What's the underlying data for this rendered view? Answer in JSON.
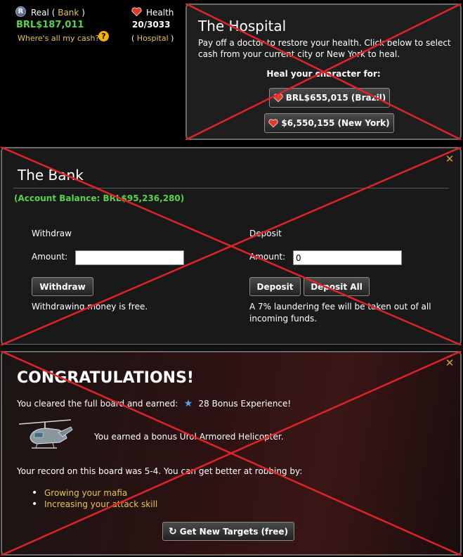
{
  "status": {
    "real_label": "Real",
    "bank_link": "Bank",
    "cash": "BRL$187,011",
    "where_cash": "Where's all my cash?",
    "health_label": "Health",
    "health_value": "20/3033",
    "hospital_link": "Hospital"
  },
  "hospital": {
    "title": "The Hospital",
    "description": "Pay off a doctor to restore your health. Click below to select cash from your current city or New York to heal.",
    "heal_label": "Heal your character for:",
    "brazil_button": "BRL$655,015 (Brazil)",
    "ny_button": "$6,550,155 (New York)"
  },
  "bank": {
    "title": "The Bank",
    "balance": "(Account Balance: BRL$95,236,280)",
    "withdraw": {
      "heading": "Withdraw",
      "amount_label": "Amount:",
      "amount_value": "",
      "button": "Withdraw",
      "note": "Withdrawing money is free."
    },
    "deposit": {
      "heading": "Deposit",
      "amount_label": "Amount:",
      "amount_value": "0",
      "button": "Deposit",
      "all_button": "Deposit All",
      "note": "A 7% laundering fee will be taken out of all incoming funds."
    }
  },
  "congrats": {
    "title": "CONGRATULATIONS!",
    "cleared_text": "You cleared the full board and earned:",
    "bonus_xp": "28 Bonus Experience!",
    "earned_item": "You earned a bonus Urol Armored Helicopter.",
    "record": "Your record on this board was 5-4. You can get better at robbing by:",
    "tips": [
      "Growing your mafia",
      "Increasing your attack skill"
    ],
    "button": "Get New Targets (free)"
  },
  "colors": {
    "cash_green": "#58d24a",
    "link_gold": "#e8c64a",
    "overlay_red": "#e0222a",
    "star_blue": "#4aa6ff"
  },
  "icons": [
    "real-currency-icon",
    "help-icon",
    "heart-icon",
    "close-icon",
    "star-icon",
    "refresh-icon",
    "helicopter-icon"
  ]
}
